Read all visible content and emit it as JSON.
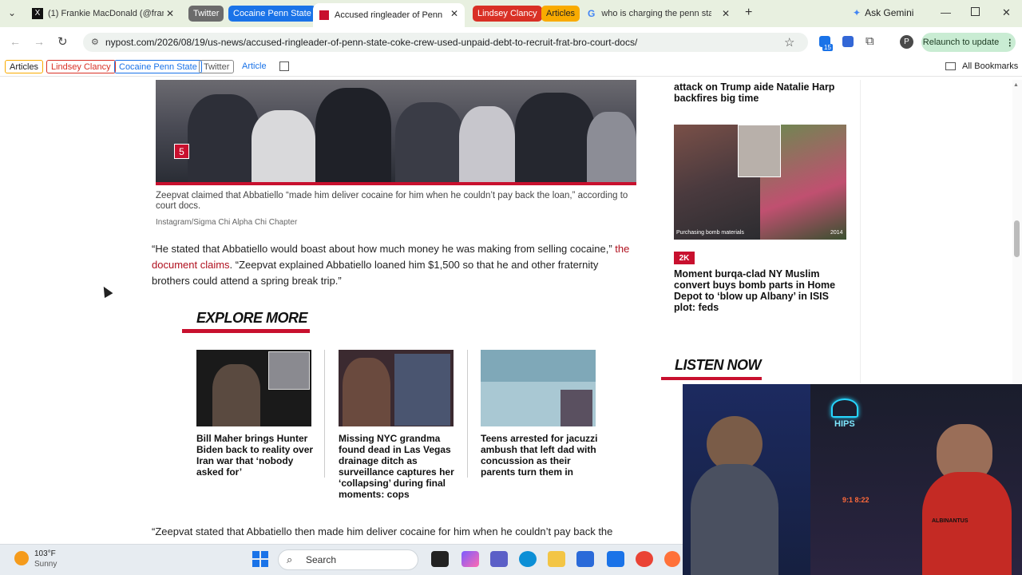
{
  "tabs": {
    "list_all_icon": "chevron-down",
    "tab1_title": "(1) Frankie MacDonald (@frank",
    "group_twitter": "Twitter",
    "group_cocaine": "Cocaine Penn State",
    "active_title": "Accused ringleader of Penn Sta",
    "group_lindsey": "Lindsey Clancy",
    "group_articles": "Articles",
    "tab_google_title": "who is charging the penn state",
    "new_tab": "+",
    "ask_gemini": "Ask Gemini"
  },
  "nav": {
    "url": "nypost.com/2026/08/19/us-news/accused-ringleader-of-penn-state-coke-crew-used-unpaid-debt-to-recruit-frat-bro-court-docs/",
    "relaunch_label": "Relaunch to update",
    "profile_initial": "P",
    "extension_badge": "15"
  },
  "bookmarks": {
    "articles": "Articles",
    "lindsey": "Lindsey Clancy",
    "cocaine": "Cocaine Penn State",
    "twitter": "Twitter",
    "article": "Article",
    "all_bookmarks": "All Bookmarks"
  },
  "article": {
    "photo_index": "5",
    "caption": "Zeepvat claimed that Abbatiello “made him deliver cocaine for him when he couldn’t pay back the loan,” according to court docs.",
    "credit": "Instagram/Sigma Chi Alpha Chi Chapter",
    "para1_text": "“He stated that Abbatiello would boast about how much money he was making from selling cocaine,”",
    "para1_link": "the document claims",
    "para1_rest": ". “Zeepvat explained Abbatiello loaned him $1,500 so that he and other fraternity brothers could attend a spring break trip.”",
    "explore_heading": "EXPLORE MORE",
    "cards": [
      {
        "title": "Bill Maher brings Hunter Biden back to reality over Iran war that ‘nobody asked for’"
      },
      {
        "title": "Missing NYC grandma found dead in Las Vegas drainage ditch as surveillance captures her ‘collapsing’ during final moments: cops"
      },
      {
        "title": "Teens arrested for jacuzzi ambush that left dad with concussion as their parents turn them in"
      }
    ],
    "para2_text": "“Zeepvat stated that Abbatiello then made him deliver cocaine for him when he couldn’t pay back the"
  },
  "sidebar": {
    "top_story": "attack on Trump aide Natalie Harp backfires big time",
    "image_caption": "Purchasing bomb materials",
    "image_year": "2014",
    "comment_count": "2K",
    "story2": "Moment burqa-clad NY Muslim convert buys bomb parts in Home Depot to ‘blow up Albany’ in ISIS plot: feds",
    "listen_heading": "LISTEN NOW"
  },
  "webcam": {
    "neon_sign": "HIPS",
    "clock": "9:1 8:22",
    "shirt_text": "ALBINANTUS"
  },
  "taskbar": {
    "temperature": "103°F",
    "condition": "Sunny",
    "search_label": "Search"
  },
  "colors": {
    "accent_red": "#c8102e",
    "link_red": "#b0101e",
    "tab_strip": "#e8f0e0",
    "relaunch_green": "#c9ecd3"
  }
}
